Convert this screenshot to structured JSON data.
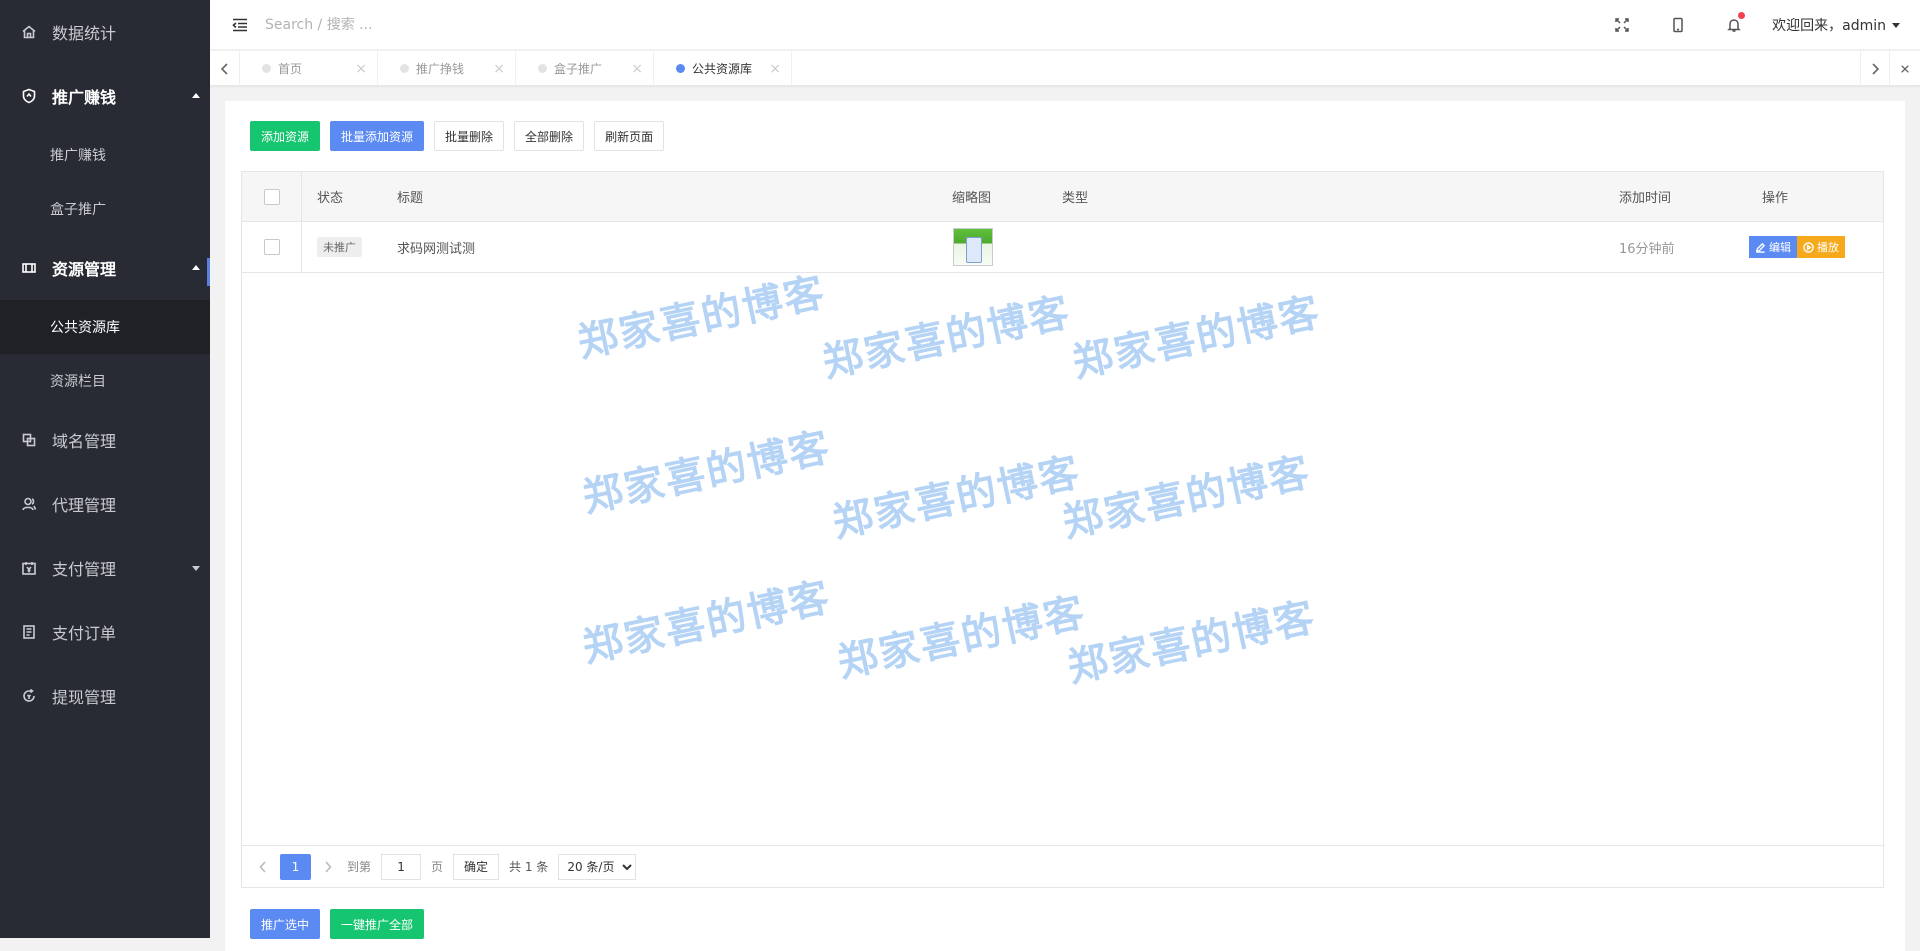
{
  "sidebar": {
    "items": [
      {
        "label": "数据统计",
        "icon": "home-icon"
      },
      {
        "label": "推广赚钱",
        "icon": "shield-icon",
        "expanded": true,
        "children": [
          "推广赚钱",
          "盒子推广"
        ]
      },
      {
        "label": "资源管理",
        "icon": "tv-icon",
        "expanded": true,
        "children": [
          "公共资源库",
          "资源栏目"
        ],
        "active_child": "公共资源库"
      },
      {
        "label": "域名管理",
        "icon": "domain-icon"
      },
      {
        "label": "代理管理",
        "icon": "users-icon"
      },
      {
        "label": "支付管理",
        "icon": "wallet-icon",
        "expanded": false
      },
      {
        "label": "支付订单",
        "icon": "receipt-icon"
      },
      {
        "label": "提现管理",
        "icon": "refresh-icon"
      }
    ]
  },
  "header": {
    "search_placeholder": "Search / 搜索 ...",
    "user_text": "欢迎回来，admin"
  },
  "tabs": [
    {
      "label": "首页",
      "active": false
    },
    {
      "label": "推广挣钱",
      "active": false
    },
    {
      "label": "盒子推广",
      "active": false
    },
    {
      "label": "公共资源库",
      "active": true
    }
  ],
  "toolbar": {
    "add": "添加资源",
    "batch_add": "批量添加资源",
    "batch_delete": "批量删除",
    "delete_all": "全部删除",
    "refresh": "刷新页面"
  },
  "table": {
    "columns": [
      "状态",
      "标题",
      "缩略图",
      "类型",
      "添加时间",
      "操作"
    ],
    "rows": [
      {
        "status": "未推广",
        "title": "求码网测试测",
        "type": "",
        "time": "16分钟前",
        "edit": "编辑",
        "play": "播放"
      }
    ]
  },
  "pager": {
    "current": "1",
    "goto_label": "到第",
    "goto_value": "1",
    "page_unit": "页",
    "confirm": "确定",
    "total": "共 1 条",
    "page_size": "20 条/页"
  },
  "bottom": {
    "promote_selected": "推广选中",
    "promote_all": "一键推广全部"
  },
  "watermark_text": "郑家喜的博客",
  "colors": {
    "sidebar_bg": "#282b33",
    "accent_blue": "#5b8af3",
    "accent_green": "#16c56f",
    "accent_orange": "#f5a91b",
    "notify_red": "#f4404d"
  }
}
